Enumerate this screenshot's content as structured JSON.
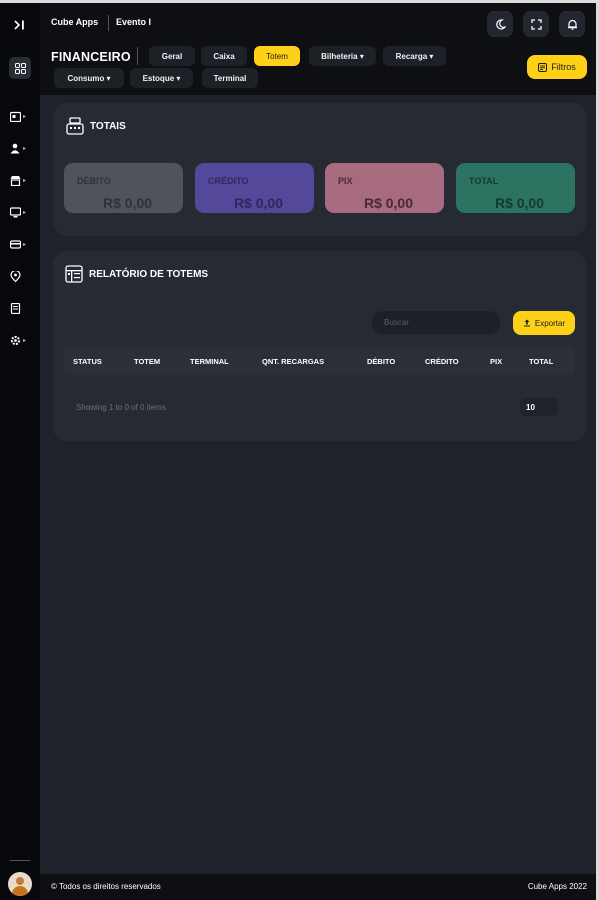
{
  "header": {
    "brand": "Cube Apps",
    "event": "Evento I",
    "icons": [
      "moon-icon",
      "fullscreen-icon",
      "bell-icon"
    ]
  },
  "page": {
    "title": "FINANCEIRO",
    "tabs": [
      {
        "label": "Geral",
        "active": false
      },
      {
        "label": "Caixa",
        "active": false
      },
      {
        "label": "Totem",
        "active": true
      },
      {
        "label": "Bilheteria ▾",
        "active": false
      },
      {
        "label": "Recarga ▾",
        "active": false
      },
      {
        "label": "Consumo ▾",
        "active": false
      },
      {
        "label": "Estoque ▾",
        "active": false
      },
      {
        "label": "Terminal",
        "active": false
      }
    ],
    "filter_label": "Filtros"
  },
  "totais": {
    "title": "TOTAIS",
    "boxes": [
      {
        "label": "DÉBITO",
        "value": "R$ 0,00",
        "bg": "#4e535c",
        "label_color": "#2f3238",
        "value_color": "#2f3238"
      },
      {
        "label": "CRÉDITO",
        "value": "R$ 0,00",
        "bg": "#53489a",
        "label_color": "#2e285c",
        "value_color": "#2e285c"
      },
      {
        "label": "PIX",
        "value": "R$ 0,00",
        "bg": "#a86a7e",
        "label_color": "#472a33",
        "value_color": "#472a33"
      },
      {
        "label": "TOTAL",
        "value": "R$ 0,00",
        "bg": "#2c7461",
        "label_color": "#143a31",
        "value_color": "#143a31"
      }
    ]
  },
  "relatorio": {
    "title": "RELATÓRIO DE TOTEMS",
    "search_placeholder": "Buscar",
    "export_label": "Exportar",
    "columns": [
      "STATUS",
      "TOTEM",
      "TERMINAL",
      "QNT. RECARGAS",
      "DÉBITO",
      "CRÉDITO",
      "PIX",
      "TOTAL"
    ],
    "showing": "Showing 1 to 0 of 0 items",
    "per_page": "10"
  },
  "footer": {
    "left": "© Todos os direitos reservados",
    "right": "Cube Apps 2022"
  },
  "colors": {
    "accent": "#fcd118",
    "background": "#1f222a",
    "card": "#262a33",
    "sidebar": "#07080b"
  }
}
